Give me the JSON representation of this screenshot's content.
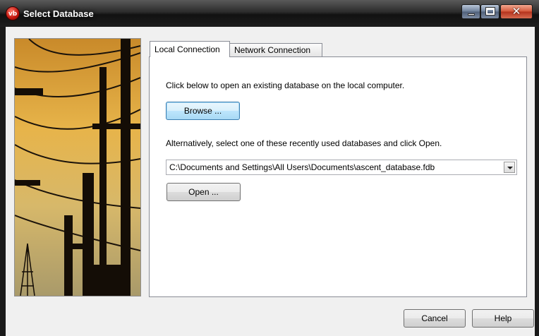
{
  "window": {
    "title": "Select Database",
    "app_icon_text": "vb",
    "controls": {
      "minimize": "minimize",
      "maximize": "maximize",
      "close": "✕"
    }
  },
  "tabs": [
    {
      "label": "Local Connection",
      "active": true
    },
    {
      "label": "Network Connection",
      "active": false
    }
  ],
  "local": {
    "intro_text": "Click below to open an existing database on the local computer.",
    "browse_label": "Browse ...",
    "recent_text": "Alternatively, select one of these recently used databases and click Open.",
    "recent_selected": "C:\\Documents and Settings\\All Users\\Documents\\ascent_database.fdb",
    "open_label": "Open ..."
  },
  "footer": {
    "cancel_label": "Cancel",
    "help_label": "Help"
  },
  "photo": {
    "subject": "power-lines-image"
  }
}
